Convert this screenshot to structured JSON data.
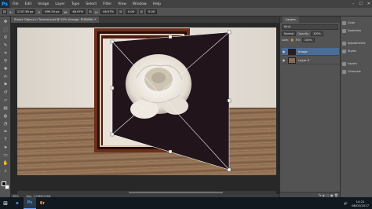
{
  "app": {
    "logo": "Ps"
  },
  "menu": [
    "File",
    "Edit",
    "Image",
    "Layer",
    "Type",
    "Select",
    "Filter",
    "View",
    "Window",
    "Help"
  ],
  "window_controls": {
    "minimize": "–",
    "maximize": "☐",
    "close": "✕"
  },
  "options": {
    "x_label": "X:",
    "x_value": "1137.36 px",
    "y_label": "Y:",
    "y_value": "899.20 px",
    "w_label": "W:",
    "w_value": "46.07%",
    "h_label": "H:",
    "h_value": "46.07%",
    "angle_value": "0.00",
    "h_skew_value": "0.00"
  },
  "document_tab": {
    "title": "Smart Object In Tutorial.psd @ 50% (Image, RGB/8#) *"
  },
  "status": {
    "zoom": "50%",
    "doc": "Doc: 7.09M/15.8M"
  },
  "layers_panel": {
    "tab": "Layers",
    "filter": "Kind",
    "blend_mode": "Normal",
    "opacity_label": "Opacity:",
    "opacity_value": "100%",
    "lock_label": "Lock:",
    "fill_label": "Fill:",
    "fill_value": "100%",
    "layers": [
      {
        "name": "Image",
        "active": true
      },
      {
        "name": "Layer 0",
        "active": false
      }
    ],
    "footer_icons": "fx ◐ ▢ ▣ 🗑"
  },
  "dock": [
    "Color",
    "Swatches",
    "Adjustments",
    "Styles",
    "Layers",
    "Channels"
  ],
  "taskbar": {
    "start": "⊞",
    "apps": [
      {
        "label": "e",
        "color": "#5fa8ff"
      },
      {
        "label": "Ps",
        "color": "#31a8ff"
      },
      {
        "label": "Br",
        "color": "#ff9a3a"
      }
    ],
    "time": "14:21",
    "date": "08/02/2017"
  },
  "colors": {
    "accent": "#4b6c94",
    "canvas_bg": "#282828"
  }
}
